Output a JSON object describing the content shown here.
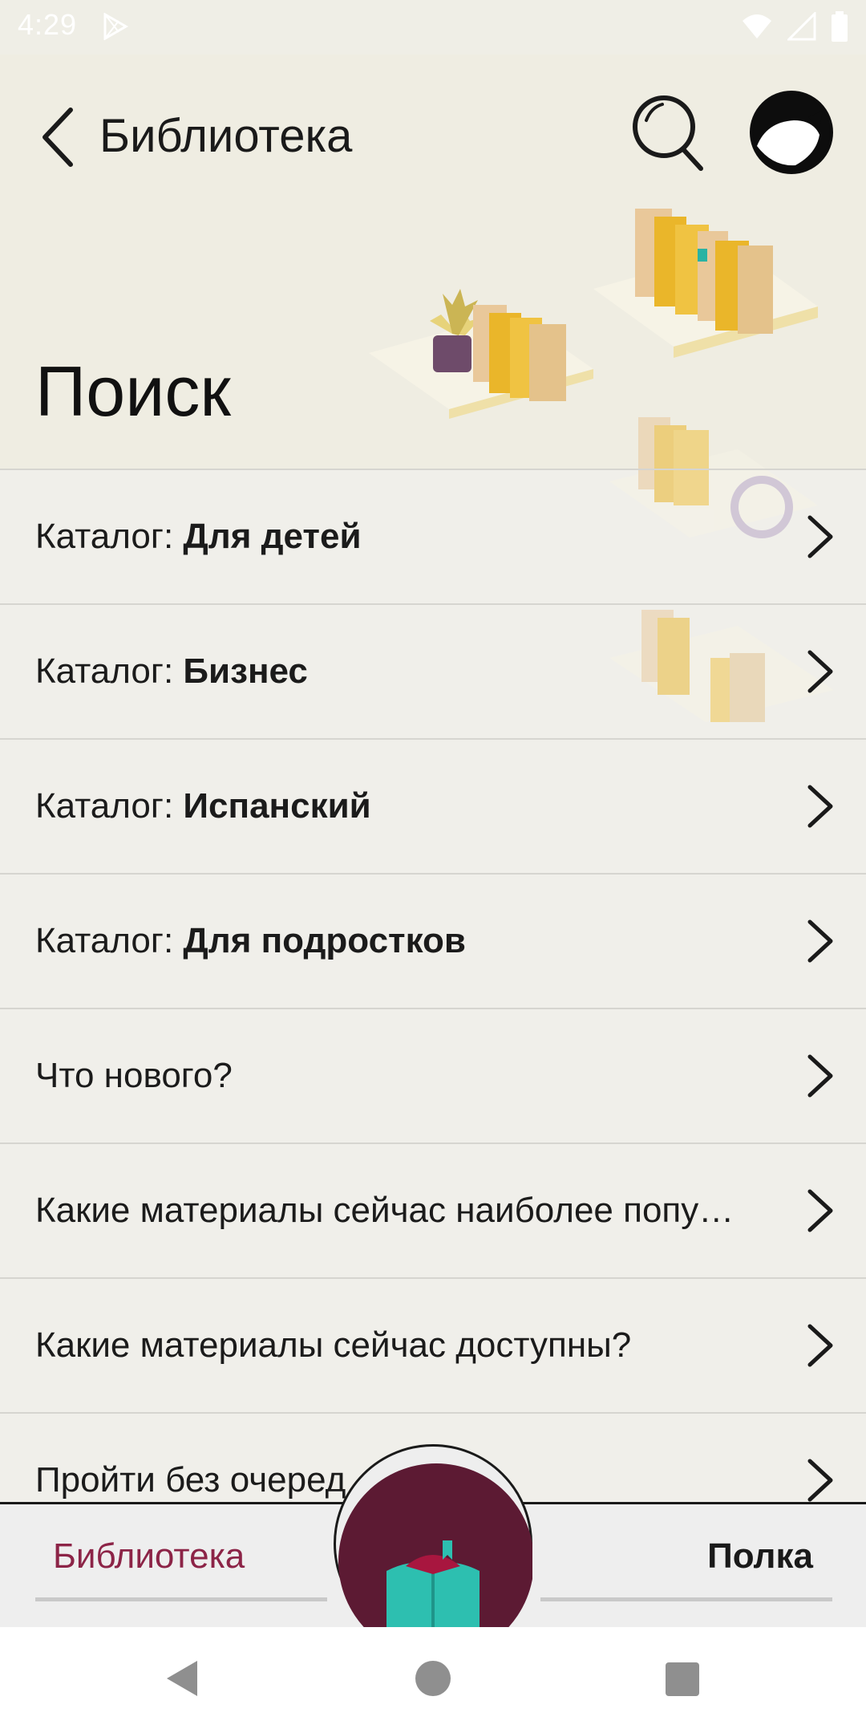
{
  "status_bar": {
    "time": "4:29"
  },
  "header": {
    "title": "Библиотека",
    "page_title": "Поиск"
  },
  "list": {
    "items": [
      {
        "prefix": "Каталог: ",
        "bold": "Для детей"
      },
      {
        "prefix": "Каталог: ",
        "bold": "Бизнес"
      },
      {
        "prefix": "Каталог: ",
        "bold": "Испанский"
      },
      {
        "prefix": "Каталог: ",
        "bold": "Для подростков"
      },
      {
        "prefix": "Что нового?",
        "bold": ""
      },
      {
        "prefix": "Какие материалы сейчас наиболее попу…",
        "bold": ""
      },
      {
        "prefix": "Какие материалы сейчас доступны?",
        "bold": ""
      },
      {
        "prefix": "Пройти без очеред",
        "bold": ""
      }
    ]
  },
  "tabbar": {
    "library_label": "Библиотека",
    "shelf_label": "Полка",
    "accent_color": "#8c2447",
    "fab_color": "#5c1a33"
  },
  "icons": {
    "back": "chevron-left-icon",
    "search": "search-icon",
    "avatar": "profile-avatar-icon",
    "row_chevron": "chevron-right-icon",
    "fab": "open-book-icon"
  }
}
